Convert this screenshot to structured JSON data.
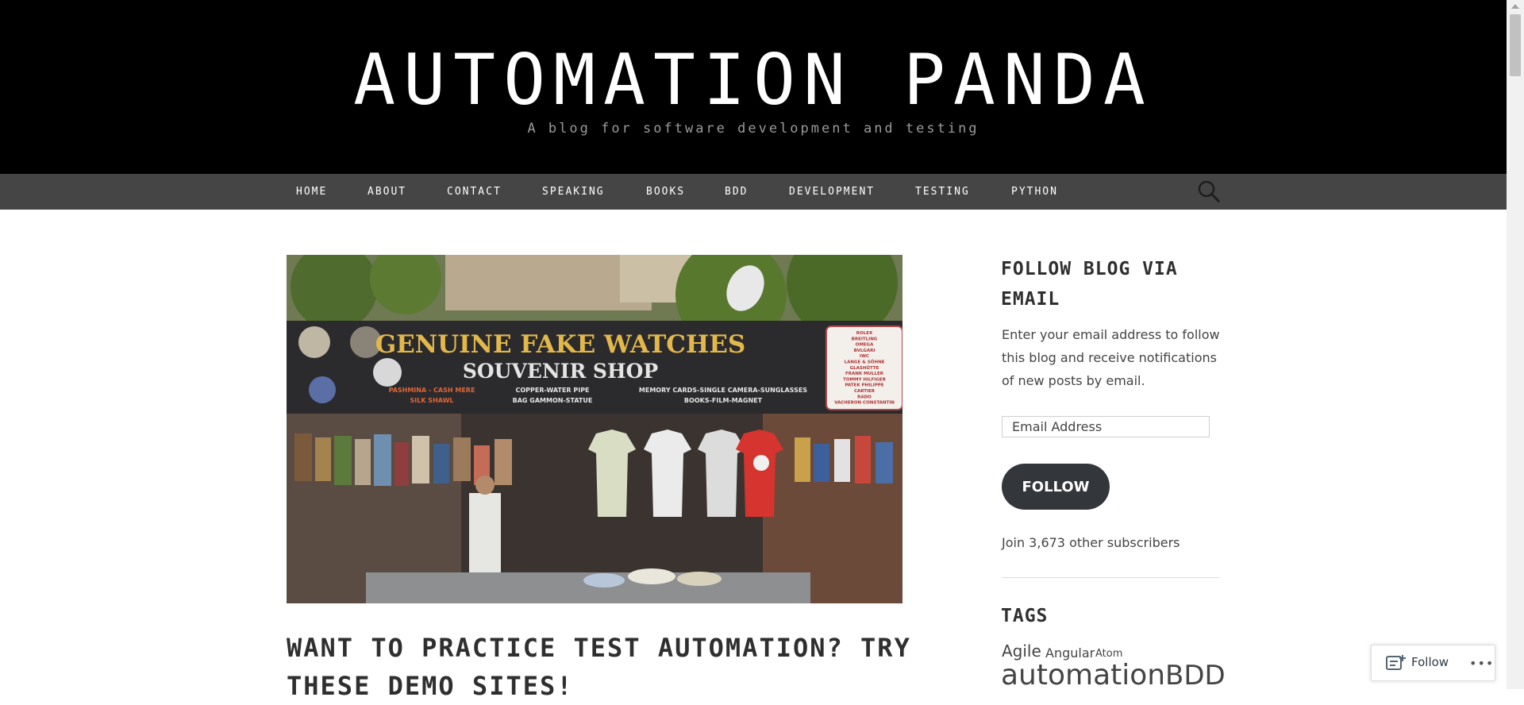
{
  "header": {
    "title": "AUTOMATION PANDA",
    "description": "A blog for software development and testing"
  },
  "nav": {
    "items": [
      "HOME",
      "ABOUT",
      "CONTACT",
      "SPEAKING",
      "BOOKS",
      "BDD",
      "DEVELOPMENT",
      "TESTING",
      "PYTHON"
    ]
  },
  "post": {
    "title": "WANT TO PRACTICE TEST AUTOMATION? TRY THESE DEMO SITES!",
    "image_sign": {
      "line1": "GENUINE FAKE WATCHES",
      "line2": "SOUVENIR SHOP",
      "small1": "PASHMINA - CASH MERE",
      "small2": "SILK SHAWL",
      "small3": "COPPER-WATER PIPE",
      "small4": "BAG GAMMON-STATUE",
      "small5": "MEMORY CARDS-SINGLE CAMERA-SUNGLASSES",
      "small6": "BOOKS-FILM-MAGNET",
      "brands": [
        "ROLEX",
        "BREITLING",
        "OMEGA",
        "BVLGARI",
        "IWC",
        "LANGE & SÖHNE",
        "GLASHÜTTE",
        "FRANK MULLER",
        "TOMMY HILFIGER",
        "PATEK PHILIPPE",
        "CARTIER",
        "RADO",
        "VACHERON CONSTANTIN"
      ]
    }
  },
  "sidebar": {
    "follow_widget": {
      "title_line1": "FOLLOW BLOG VIA",
      "title_line2": "EMAIL",
      "text": "Enter your email address to follow this blog and receive notifications of new posts by email.",
      "email_placeholder": "Email Address",
      "button_label": "FOLLOW",
      "subscribers": "Join 3,673 other subscribers"
    },
    "tags_widget": {
      "title": "TAGS",
      "tags": [
        "Agile",
        "Angular",
        "Atom",
        "automation",
        "BDD"
      ]
    }
  },
  "floating_bar": {
    "follow_label": "Follow",
    "more_label": "•••"
  },
  "colors": {
    "header_bg": "#000000",
    "nav_bg": "#454545",
    "button_bg": "#33363b"
  }
}
